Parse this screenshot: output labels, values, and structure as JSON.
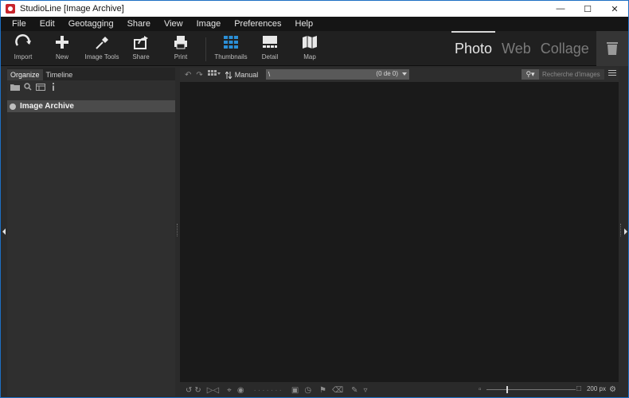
{
  "window": {
    "title": "StudioLine [Image Archive]"
  },
  "menu": [
    "File",
    "Edit",
    "Geotagging",
    "Share",
    "View",
    "Image",
    "Preferences",
    "Help"
  ],
  "toolbar": {
    "import": "Import",
    "new": "New",
    "image_tools": "Image Tools",
    "share": "Share",
    "print": "Print",
    "thumbnails": "Thumbnails",
    "detail": "Detail",
    "map": "Map"
  },
  "modes": {
    "photo": "Photo",
    "web": "Web",
    "collage": "Collage"
  },
  "left_panel": {
    "tabs": [
      "Organize",
      "Timeline"
    ],
    "tree": {
      "item": "Image Archive"
    }
  },
  "main_bar": {
    "sort": "Manual",
    "path": "\\",
    "count": "(0 de 0)",
    "search_placeholder": "Recherche d'images"
  },
  "bottom_bar": {
    "zoom": "200 px"
  },
  "colors": {
    "accent": "#1d6fc4",
    "thumbnails_icon": "#2b8fd6"
  }
}
